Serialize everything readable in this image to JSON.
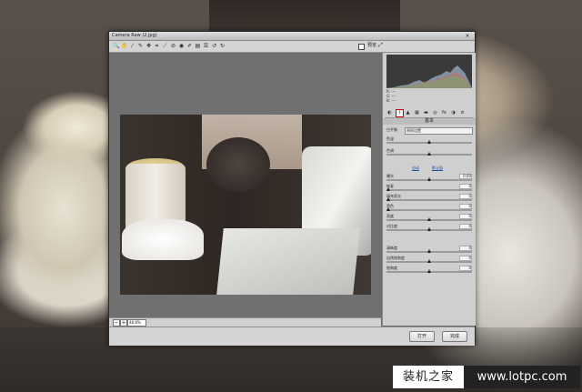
{
  "window": {
    "title": "Camera Raw (2.jpg)",
    "close_glyph": "×"
  },
  "toolbar": {
    "tools": [
      {
        "name": "zoom-tool-icon",
        "glyph": "🔍"
      },
      {
        "name": "hand-tool-icon",
        "glyph": "✋"
      },
      {
        "name": "white-balance-tool-icon",
        "glyph": "⁄"
      },
      {
        "name": "color-sampler-tool-icon",
        "glyph": "✎"
      },
      {
        "name": "target-adjust-tool-icon",
        "glyph": "✥"
      },
      {
        "name": "crop-tool-icon",
        "glyph": "⌗"
      },
      {
        "name": "straighten-tool-icon",
        "glyph": "⟋"
      },
      {
        "name": "spot-removal-tool-icon",
        "glyph": "⊘"
      },
      {
        "name": "red-eye-tool-icon",
        "glyph": "◉"
      },
      {
        "name": "adjustment-brush-icon",
        "glyph": "✐"
      },
      {
        "name": "graduated-filter-icon",
        "glyph": "▤"
      },
      {
        "name": "preferences-icon",
        "glyph": "☰"
      },
      {
        "name": "rotate-left-icon",
        "glyph": "↺"
      },
      {
        "name": "rotate-right-icon",
        "glyph": "↻"
      }
    ],
    "preview_label": "预览"
  },
  "histogram": {
    "rgb_lines": [
      "R: ---",
      "G: ---",
      "B: ---"
    ]
  },
  "panel": {
    "section_title": "基本",
    "tabs": [
      {
        "name": "tab-basic",
        "glyph": "◐"
      },
      {
        "name": "tab-tone-curve",
        "glyph": "⌇"
      },
      {
        "name": "tab-detail",
        "glyph": "▲"
      },
      {
        "name": "tab-hsl",
        "glyph": "▦"
      },
      {
        "name": "tab-split-toning",
        "glyph": "▬"
      },
      {
        "name": "tab-lens",
        "glyph": "◎"
      },
      {
        "name": "tab-effects",
        "glyph": "fx"
      },
      {
        "name": "tab-camera-calibration",
        "glyph": "◑"
      },
      {
        "name": "tab-presets",
        "glyph": "≡"
      }
    ],
    "white_balance": {
      "label": "白平衡",
      "value": "原照设置"
    },
    "top_sliders": [
      {
        "name": "temperature",
        "label": "色温",
        "value": "",
        "pos": 0.5
      },
      {
        "name": "tint",
        "label": "色调",
        "value": "",
        "pos": 0.5
      }
    ],
    "auto_label": "自动",
    "default_label": "默认值",
    "tone_sliders": [
      {
        "name": "exposure",
        "label": "曝光",
        "value": "0.00",
        "pos": 0.5
      },
      {
        "name": "recovery",
        "label": "恢复",
        "value": "0",
        "pos": 0.02
      },
      {
        "name": "fill-light",
        "label": "填充亮光",
        "value": "0",
        "pos": 0.02
      },
      {
        "name": "blacks",
        "label": "黑色",
        "value": "0",
        "pos": 0.02
      },
      {
        "name": "brightness",
        "label": "亮度",
        "value": "0",
        "pos": 0.5
      },
      {
        "name": "contrast",
        "label": "对比度",
        "value": "0",
        "pos": 0.5
      }
    ],
    "presence_sliders": [
      {
        "name": "clarity",
        "label": "清晰度",
        "value": "0",
        "pos": 0.5
      },
      {
        "name": "vibrance",
        "label": "自然饱和度",
        "value": "0",
        "pos": 0.5
      },
      {
        "name": "saturation",
        "label": "饱和度",
        "value": "0",
        "pos": 0.5
      }
    ]
  },
  "footer": {
    "zoom_value": "48.8%",
    "open_label": "打开",
    "done_label": "完成"
  },
  "watermark": {
    "site_name": "装机之家",
    "url": "www.lotpc.com"
  },
  "colors": {
    "active_tab_border": "#d00000",
    "link": "#1a4da0"
  }
}
